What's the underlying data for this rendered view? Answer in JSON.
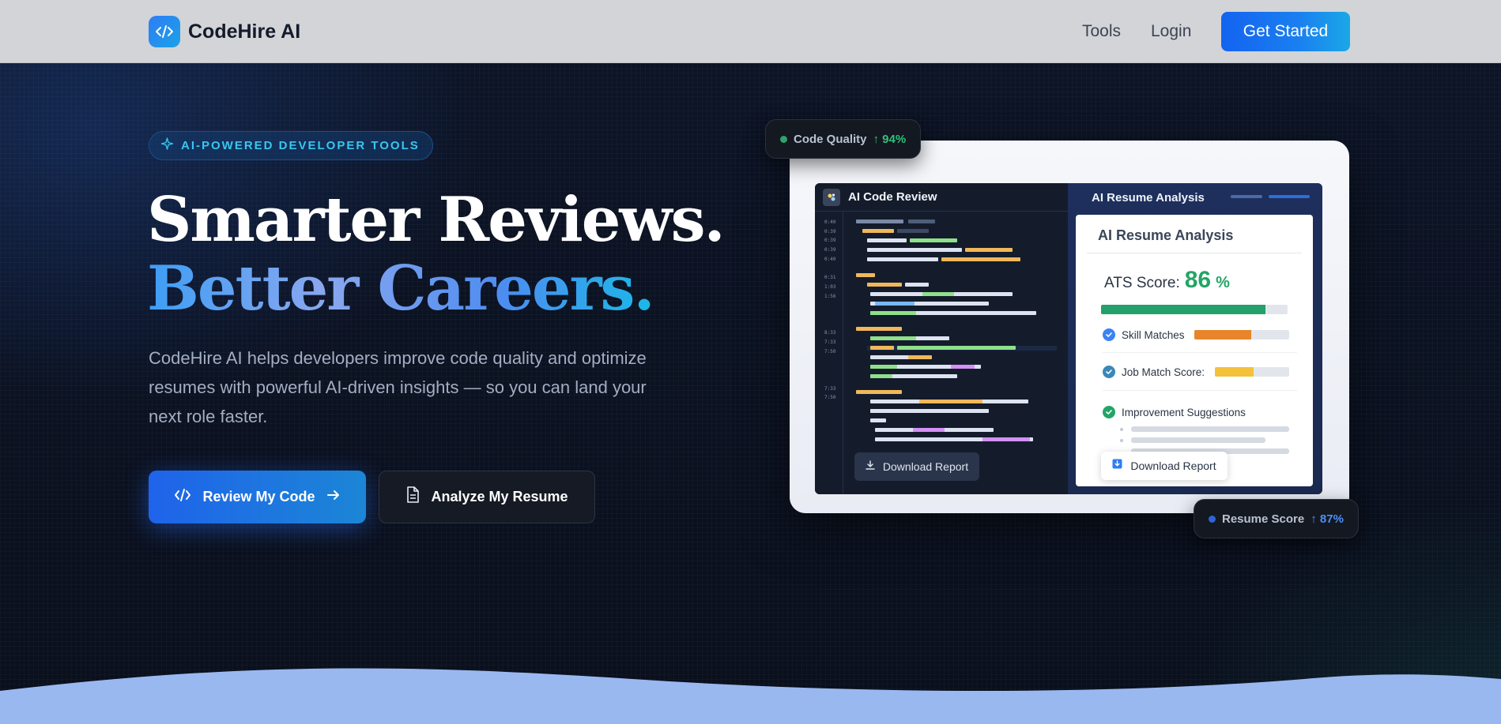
{
  "nav": {
    "brand": "CodeHire AI",
    "links": {
      "tools": "Tools",
      "login": "Login"
    },
    "cta": "Get Started"
  },
  "hero": {
    "badge": "AI-POWERED DEVELOPER TOOLS",
    "headline_line1": "Smarter Reviews.",
    "headline_line2": "Better Careers.",
    "description": "CodeHire AI helps developers improve code quality and optimize resumes with powerful AI-driven insights — so you can land your next role faster.",
    "primary_button": "Review My Code",
    "secondary_button": "Analyze My Resume"
  },
  "mockup": {
    "code_review": {
      "title": "AI Code Review",
      "download": "Download Report"
    },
    "resume": {
      "header": "AI Resume Analysis",
      "card_title": "AI Resume Analysis",
      "ats_label": "ATS Score:",
      "ats_value": "86",
      "ats_unit": "%",
      "ats_fraction": 0.88,
      "skill_matches": "Skill Matches",
      "skill_matches_fraction": 0.6,
      "job_match": "Job Match Score:",
      "job_match_fraction": 0.52,
      "improvements": "Improvement Suggestions",
      "download": "Download Report"
    }
  },
  "chips": {
    "code_quality_label": "Code Quality",
    "code_quality_value": "↑ 94%",
    "resume_score_label": "Resume Score",
    "resume_score_value": "↑ 87%"
  },
  "colors": {
    "brand_blue": "#1463f0",
    "accent_cyan": "#38c6f0",
    "success_green": "#22a566",
    "warning_orange": "#e8842a",
    "warning_yellow": "#f4c23a",
    "wave": "#9ab8f0"
  }
}
